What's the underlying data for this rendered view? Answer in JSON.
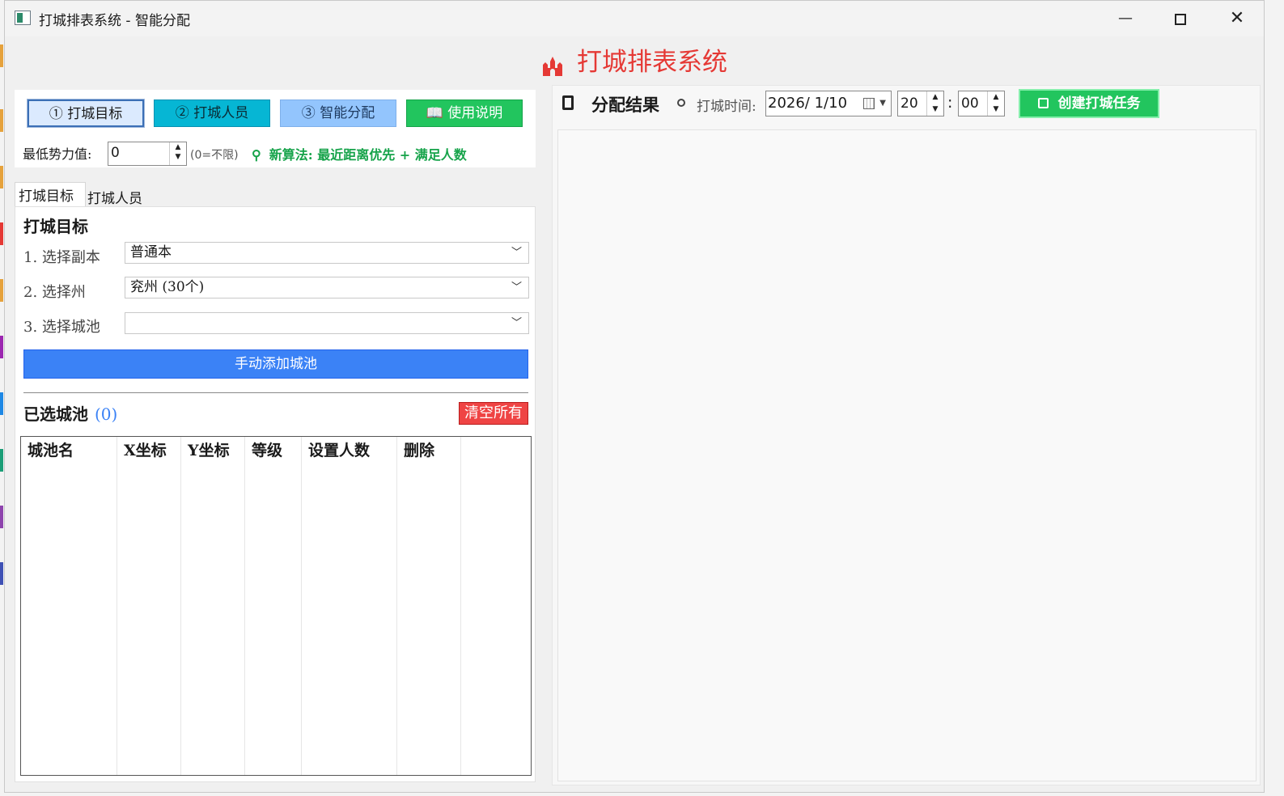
{
  "window": {
    "title": "打城排表系统 - 智能分配"
  },
  "window_controls": {
    "minimize": "—",
    "close": "✕"
  },
  "header": {
    "title": "打城排表系统"
  },
  "steps": [
    {
      "label": "① 打城目标"
    },
    {
      "label": "② 打城人员"
    },
    {
      "label": "③ 智能分配"
    },
    {
      "label": "📖 使用说明"
    }
  ],
  "min_power": {
    "label": "最低势力值:",
    "value": "0",
    "hint": "(0=不限)"
  },
  "algorithm_note": "新算法: 最近距离优先 + 满足人数",
  "tabs": [
    {
      "label": "打城目标"
    },
    {
      "label": "打城人员"
    }
  ],
  "target_section": {
    "title": "打城目标",
    "fields": [
      {
        "label": "1.  选择副本",
        "value": "普通本"
      },
      {
        "label": "2.  选择州",
        "value": "兖州 (30个)"
      },
      {
        "label": "3.  选择城池",
        "value": ""
      }
    ],
    "manual_add_button": "手动添加城池"
  },
  "selected": {
    "title": "已选城池",
    "count": "(0)",
    "clear_button": "清空所有",
    "columns": [
      "城池名",
      "X坐标",
      "Y坐标",
      "等级",
      "设置人数",
      "删除",
      ""
    ]
  },
  "result": {
    "title": "分配结果",
    "time_label": "打城时间:",
    "date": "2026/  1/10",
    "hour": "20",
    "colon": ":",
    "minute": "00",
    "create_button": "创建打城任务"
  }
}
